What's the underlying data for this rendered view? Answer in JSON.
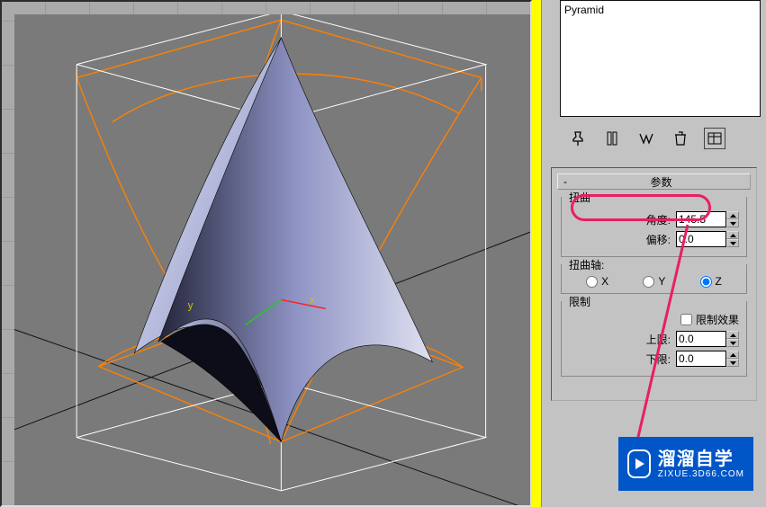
{
  "sceneList": {
    "items": [
      "Pyramid"
    ]
  },
  "icons": {
    "pin": "pin-icon",
    "config_i": "config-1-icon",
    "config_ii": "config-2-icon",
    "forks": "double-v-icon",
    "trash": "trash-icon",
    "preset": "preset-icon"
  },
  "rollout": {
    "toggle": "-",
    "title": "参数"
  },
  "twist": {
    "legend": "扭曲",
    "angleLabel": "角度:",
    "angleValue": "145.5",
    "biasLabel": "偏移:",
    "biasValue": "0.0"
  },
  "axis": {
    "legend": "扭曲轴:",
    "x": "X",
    "y": "Y",
    "z": "Z",
    "selected": "z"
  },
  "limits": {
    "legend": "限制",
    "effectLabel": "限制效果",
    "effectChecked": false,
    "upperLabel": "上限:",
    "upperValue": "0.0",
    "lowerLabel": "下限:",
    "lowerValue": "0.0"
  },
  "watermark": {
    "title": "溜溜自学",
    "url": "ZIXUE.3D66.COM"
  }
}
